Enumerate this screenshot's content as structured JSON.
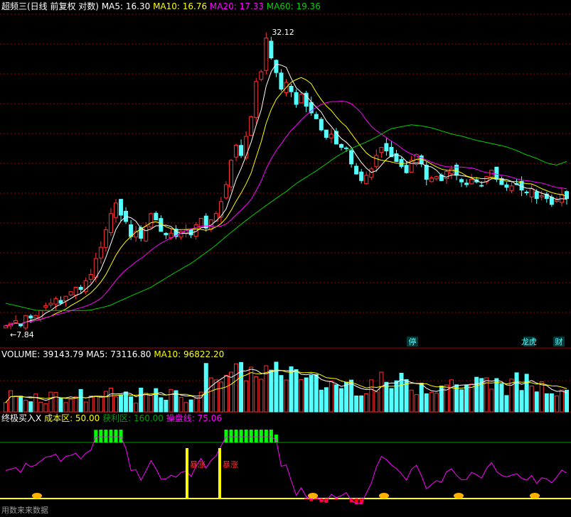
{
  "panels": {
    "price": {
      "title": "超频三(日线 前复权 对数)",
      "ma_items": [
        {
          "label": "MA5: 16.30",
          "color": "#ffffff"
        },
        {
          "label": "MA10: 16.76",
          "color": "#ffff00"
        },
        {
          "label": "MA20: 17.33",
          "color": "#ff00ff"
        },
        {
          "label": "MA60: 19.36",
          "color": "#00d000"
        }
      ],
      "high_label": "32.12",
      "low_label": "7.84",
      "event_labels": [
        "停",
        "龙虎",
        "财"
      ]
    },
    "volume": {
      "items": [
        {
          "label": "VOLUME: 39143.79",
          "color": "#ffffff"
        },
        {
          "label": "MA5: 73116.80",
          "color": "#ffffff"
        },
        {
          "label": "MA10: 96822.20",
          "color": "#ffff00"
        }
      ]
    },
    "indicator": {
      "title": "终极买入X",
      "items": [
        {
          "label": "成本区: 50.00",
          "color": "#ffff00"
        },
        {
          "label": "获利区: 160.00",
          "color": "#00a000"
        },
        {
          "label": "操盘线: 75.06",
          "color": "#ff00ff"
        }
      ],
      "surge_label": "暴涨",
      "watermark": "用数来来数据"
    }
  },
  "colors": {
    "up": "#ff3030",
    "down": "#54ffff",
    "ma5": "#ffffff",
    "ma10": "#ffff00",
    "ma20": "#ff00ff",
    "ma60": "#00d000",
    "grid": "#a00000",
    "profit_bar": "#00ff00",
    "low_bar": "#ff0000",
    "signal": "#ffff00"
  },
  "chart_data": [
    {
      "type": "candlestick",
      "title": "超频三(日线 前复权 对数)",
      "scale": "log",
      "ylim": [
        7.5,
        34
      ],
      "annotations": {
        "high": 32.12,
        "low": 7.84
      },
      "close": [
        8.0,
        8.1,
        8.2,
        8.0,
        8.4,
        8.3,
        8.4,
        8.6,
        8.8,
        8.9,
        9.1,
        8.9,
        9.2,
        9.4,
        9.6,
        9.5,
        9.9,
        10.2,
        11.0,
        11.6,
        12.6,
        13.6,
        14.3,
        13.5,
        13.1,
        12.2,
        12.5,
        12.1,
        12.8,
        13.6,
        13.2,
        12.5,
        12.3,
        12.4,
        12.2,
        12.5,
        12.6,
        12.3,
        12.9,
        13.3,
        12.7,
        13.2,
        13.6,
        14.4,
        15.6,
        17.5,
        18.8,
        17.9,
        19.6,
        21.5,
        25.4,
        26.6,
        31.2,
        28.4,
        26.5,
        24.5,
        25.3,
        24.2,
        22.8,
        23.9,
        22.6,
        21.9,
        21.3,
        20.2,
        19.5,
        19.8,
        18.9,
        18.6,
        18.5,
        17.2,
        16.4,
        15.9,
        16.3,
        16.8,
        17.9,
        18.6,
        18.3,
        17.8,
        17.4,
        17.0,
        16.5,
        17.5,
        18.0,
        17.2,
        16.0,
        16.1,
        16.2,
        15.9,
        16.6,
        16.8,
        16.3,
        15.8,
        15.6,
        16.0,
        15.8,
        15.5,
        16.2,
        16.7,
        16.0,
        15.6,
        15.4,
        15.5,
        15.6,
        15.2,
        15.0,
        15.3,
        14.6,
        14.8,
        14.6,
        14.2,
        14.5,
        14.9,
        14.6
      ],
      "ma60": [
        8.9,
        8.8,
        8.7,
        8.6,
        8.6,
        8.6,
        8.6,
        8.6,
        8.6,
        8.7,
        8.8,
        9.0,
        9.2,
        9.4,
        9.6,
        9.9,
        10.2,
        10.5,
        10.8,
        11.2,
        11.6,
        12.1,
        12.6,
        13.1,
        13.6,
        14.1,
        14.6,
        15.1,
        15.7,
        16.2,
        16.7,
        17.3,
        17.9,
        18.4,
        18.8,
        19.2,
        19.7,
        20.3,
        20.5,
        20.7,
        20.6,
        20.4,
        20.1,
        19.8,
        19.6,
        19.3,
        19.1,
        18.9,
        18.7,
        18.4,
        18.0,
        17.7,
        17.3,
        17.1,
        17.4
      ],
      "volume": {
        "last": 39143.79,
        "ma5": 73116.8,
        "ma10": 96822.2
      },
      "indicator": {
        "name": "终极买入X",
        "cost_zone": 50.0,
        "profit_zone": 160.0,
        "trade_line": 75.06,
        "signals": [
          "暴涨",
          "暴涨"
        ]
      }
    }
  ]
}
